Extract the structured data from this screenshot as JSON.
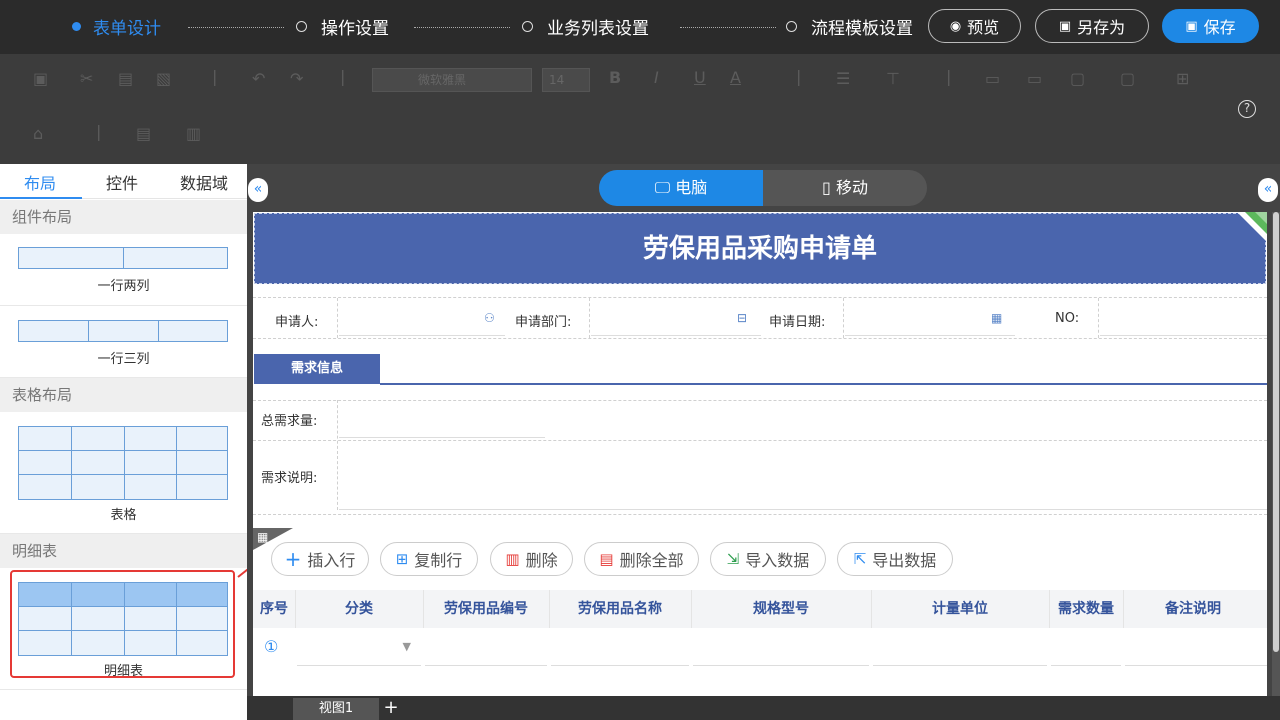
{
  "steps": [
    {
      "label": "表单设计",
      "active": true
    },
    {
      "label": "操作设置",
      "active": false
    },
    {
      "label": "业务列表设置",
      "active": false
    },
    {
      "label": "流程模板设置",
      "active": false
    }
  ],
  "top_buttons": {
    "preview": "预览",
    "save_as": "另存为",
    "save": "保存"
  },
  "toolbar": {
    "font": "微软雅黑",
    "size": "14",
    "help": "?"
  },
  "sidebar": {
    "tabs": [
      "布局",
      "控件",
      "数据域"
    ],
    "sections": {
      "component_layout": "组件布局",
      "table_layout": "表格布局",
      "detail": "明细表"
    },
    "items": {
      "two_col": "一行两列",
      "three_col": "一行三列",
      "table": "表格",
      "detail_table": "明细表"
    }
  },
  "device": {
    "desktop": "电脑",
    "mobile": "移动"
  },
  "collapse": {
    "left": "«",
    "right": "«"
  },
  "form": {
    "title": "劳保用品采购申请单",
    "fields": {
      "applicant": "申请人:",
      "dept": "申请部门:",
      "date": "申请日期:",
      "no": "NO:"
    },
    "section": "需求信息",
    "total": "总需求量:",
    "desc": "需求说明:"
  },
  "actions": {
    "insert": "插入行",
    "copy": "复制行",
    "delete": "删除",
    "delete_all": "删除全部",
    "import": "导入数据",
    "export": "导出数据"
  },
  "table": {
    "headers": [
      "序号",
      "分类",
      "劳保用品编号",
      "劳保用品名称",
      "规格型号",
      "计量单位",
      "需求数量",
      "备注说明"
    ],
    "row_index": "①"
  },
  "tabs": {
    "view1": "视图1",
    "add": "+"
  }
}
